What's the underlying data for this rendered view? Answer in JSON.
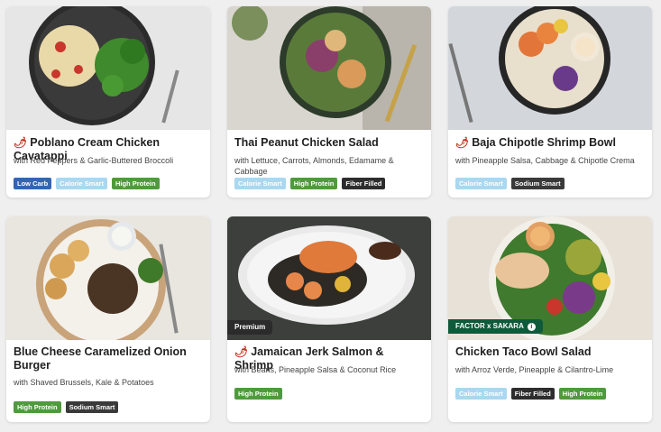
{
  "meals": [
    {
      "title": "Poblano Cream Chicken Cavatappi",
      "spicy": true,
      "subtitle": "with Red Peppers & Garlic-Buttered Broccoli",
      "tags": [
        "Low Carb",
        "Calorie Smart",
        "High Protein"
      ]
    },
    {
      "title": "Thai Peanut Chicken Salad",
      "spicy": false,
      "subtitle": "with Lettuce, Carrots, Almonds, Edamame & Cabbage",
      "tags": [
        "Calorie Smart",
        "High Protein",
        "Fiber Filled"
      ]
    },
    {
      "title": "Baja Chipotle Shrimp Bowl",
      "spicy": true,
      "subtitle": "with Pineapple Salsa, Cabbage & Chipotle Crema",
      "tags": [
        "Calorie Smart",
        "Sodium Smart"
      ]
    },
    {
      "title": "Blue Cheese Caramelized Onion Burger",
      "spicy": false,
      "subtitle": "with Shaved Brussels, Kale & Potatoes",
      "tags": [
        "High Protein",
        "Sodium Smart"
      ]
    },
    {
      "title": "Jamaican Jerk Salmon & Shrimp",
      "spicy": true,
      "subtitle": "with Beans, Pineapple Salsa & Coconut Rice",
      "tags": [
        "High Protein"
      ],
      "badge": "Premium"
    },
    {
      "title": "Chicken Taco Bowl Salad",
      "spicy": false,
      "subtitle": "with Arroz Verde, Pineapple & Cilantro-Lime",
      "tags": [
        "Calorie Smart",
        "Fiber Filled",
        "High Protein"
      ],
      "badge": "FACTOR x SAKARA"
    }
  ],
  "icons": {
    "spicy": "chili-pepper-icon",
    "partner_info": "info-icon"
  },
  "colors": {
    "low_carb": "#3465b3",
    "calorie_smart": "#a9d8f0",
    "high_protein": "#4f9a3d",
    "fiber_filled": "#2d2d2d",
    "sodium_smart": "#3a3a3a",
    "premium_badge": "#2b2b2b",
    "partner_badge": "#0f5a3a"
  }
}
